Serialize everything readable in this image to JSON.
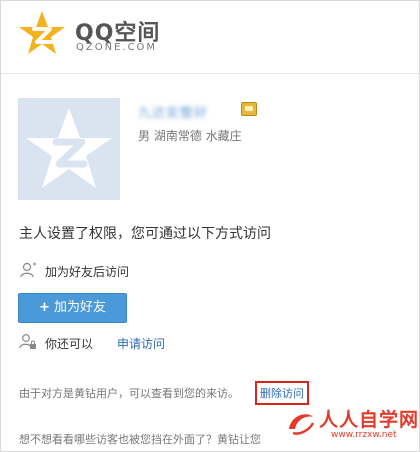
{
  "brand": {
    "title": "QQ空间",
    "subtitle": "QZONE.COM"
  },
  "profile": {
    "nickname": "九达安整好",
    "location": "男 湖南常德 水藏庄"
  },
  "permission_text": "主人设置了权限，您可通过以下方式访问",
  "friend_access_text": "加为好友后访问",
  "add_friend_button": {
    "plus": "+",
    "label": "加为好友"
  },
  "apply": {
    "prefix": "你还可以",
    "link": "申请访问"
  },
  "notice": {
    "text": "由于对方是黄钻用户，可以查看到您的来访。",
    "delete_link": "删除访问"
  },
  "footer_text": "想不想看看哪些访客也被您挡在外面了？黄钻让您",
  "watermark": {
    "title": "人人自学网",
    "url": "www.rrzxw.net"
  },
  "colors": {
    "accent_blue": "#4a9ad9",
    "link_blue": "#2d6bb5",
    "highlight_red": "#d9251d",
    "brand_yellow": "#f4b21f"
  }
}
